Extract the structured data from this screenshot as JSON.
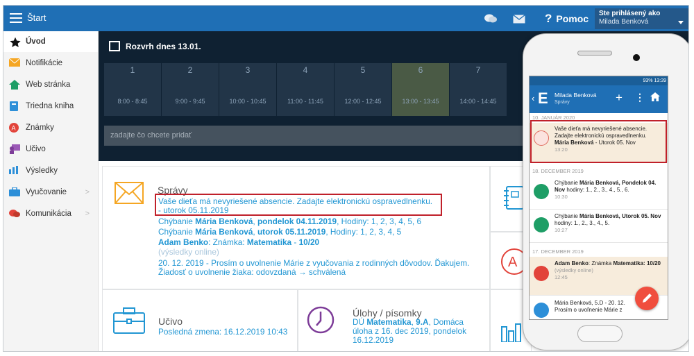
{
  "topbar": {
    "menu_label": "Štart",
    "help_label": "Pomoc",
    "help_mark": "?",
    "user_label": "Ste prihlásený ako",
    "user_name": "Milada Benková"
  },
  "sidebar": {
    "items": [
      {
        "label": "Úvod",
        "icon": "star-icon",
        "active": true
      },
      {
        "label": "Notifikácie",
        "icon": "envelope-icon"
      },
      {
        "label": "Web stránka",
        "icon": "home-icon"
      },
      {
        "label": "Triedna kniha",
        "icon": "book-icon"
      },
      {
        "label": "Známky",
        "icon": "grade-icon"
      },
      {
        "label": "Učivo",
        "icon": "teacher-icon"
      },
      {
        "label": "Výsledky",
        "icon": "bar-chart-icon"
      },
      {
        "label": "Vyučovanie",
        "icon": "briefcase-icon",
        "chevron": ">"
      },
      {
        "label": "Komunikácia",
        "icon": "chat-icon",
        "chevron": ">"
      }
    ]
  },
  "schedule": {
    "title": "Rozvrh dnes 13.01.",
    "periods": [
      {
        "num": "1",
        "time": "8:00 - 8:45"
      },
      {
        "num": "2",
        "time": "9:00 - 9:45"
      },
      {
        "num": "3",
        "time": "10:00 - 10:45"
      },
      {
        "num": "4",
        "time": "11:00 - 11:45"
      },
      {
        "num": "5",
        "time": "12:00 - 12:45"
      },
      {
        "num": "6",
        "time": "13:00 - 13:45",
        "current": true
      },
      {
        "num": "7",
        "time": "14:00 - 14:45"
      }
    ],
    "add_placeholder": "zadajte čo chcete pridať"
  },
  "spravy": {
    "title": "Správy",
    "msg1": "Vaše dieťa má nevyriešené absencie. Zadajte elektronickú ospravedlnenku.",
    "msg1_date": "- utorok 05.11.2019",
    "msg2_a": "Chýbanie ",
    "msg2_b": "Mária Benková",
    "msg2_c": ", ",
    "msg2_d": "pondelok 04.11.2019",
    "msg2_e": ", Hodiny: 1, 2, 3, 4, 5, 6",
    "msg3_a": "Chýbanie ",
    "msg3_b": "Mária Benková",
    "msg3_c": ", ",
    "msg3_d": "utorok 05.11.2019",
    "msg3_e": ", Hodiny: 1, 2, 3, 4, 5",
    "msg4_a": "Adam Benko",
    "msg4_b": ": Známka: ",
    "msg4_c": "Matematika",
    "msg4_d": " - ",
    "msg4_e": "10/20",
    "msg4_sub": "(výsledky online)",
    "msg5": "20. 12. 2019 - Prosím o uvolnenie Márie z vyučovania z rodinných dôvodov. Ďakujem.",
    "msg5_status": "Žiadosť o uvolnenie žiaka: odovzdaná → schválená"
  },
  "ucivo": {
    "title": "Učivo",
    "subtitle": "Posledná zmena: 16.12.2019 10:43"
  },
  "ulohy": {
    "title": "Úlohy / písomky",
    "line_a": "DÚ ",
    "line_b": "Matematika",
    "line_c": ", ",
    "line_d": "9.A",
    "line_e": ", Domáca úloha z 16. dec 2019, pondelok 16.12.2019"
  },
  "phone": {
    "status": "93% 13:39",
    "app_name": "Milada Benková",
    "app_sub": "Správy",
    "back": "‹",
    "logo": "E",
    "plus": "+",
    "dots": "⋮",
    "date1": "10. JANUÁR 2020",
    "item1_text": "Vaše dieťa má nevyriešené absencie. Zadajte elektronickú ospravedlnenku.",
    "item1_name": "Mária Benková",
    "item1_day": " - Utorok 05. Nov",
    "item1_time": "13:20",
    "date2": "18. DECEMBER 2019",
    "item2_a": "Chýbanie ",
    "item2_b": "Mária Benková, Pondelok 04. Nov",
    "item2_c": " hodiny: 1., 2., 3., 4., 5., 6.",
    "item2_time": "10:30",
    "item3_a": "Chýbanie ",
    "item3_b": "Mária Benková, Utorok 05. Nov",
    "item3_c": " hodiny: 1., 2., 3., 4., 5.",
    "item3_time": "10:27",
    "date3": "17. DECEMBER 2019",
    "item4_a": "Adam Benko",
    "item4_b": ": Známka ",
    "item4_c": "Matematika: 10/20",
    "item4_sub": "(výsledky online)",
    "item4_time": "12:45",
    "item5_text": "Mária Benková, 5.D - 20. 12. Prosím o uvoľnenie Márie z"
  },
  "colors": {
    "brand": "#1f6fb5",
    "link": "#2196d3",
    "highlight": "#c0202a",
    "fab": "#f04e3e"
  }
}
